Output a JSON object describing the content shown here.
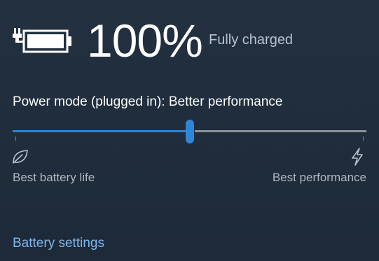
{
  "battery": {
    "percent_label": "100%",
    "status": "Fully charged",
    "charging": true,
    "icon": "battery-plugged-icon"
  },
  "power_mode": {
    "label": "Power mode (plugged in): Better performance",
    "value_fraction": 0.5,
    "min_label": "Best battery life",
    "max_label": "Best performance",
    "min_icon": "leaf-icon",
    "max_icon": "lightning-bolt-icon"
  },
  "links": {
    "battery_settings": "Battery settings"
  },
  "colors": {
    "background": "#1f2937",
    "accent": "#2f86d6",
    "link": "#7fb6f0",
    "muted_text": "#aeb6bf"
  }
}
